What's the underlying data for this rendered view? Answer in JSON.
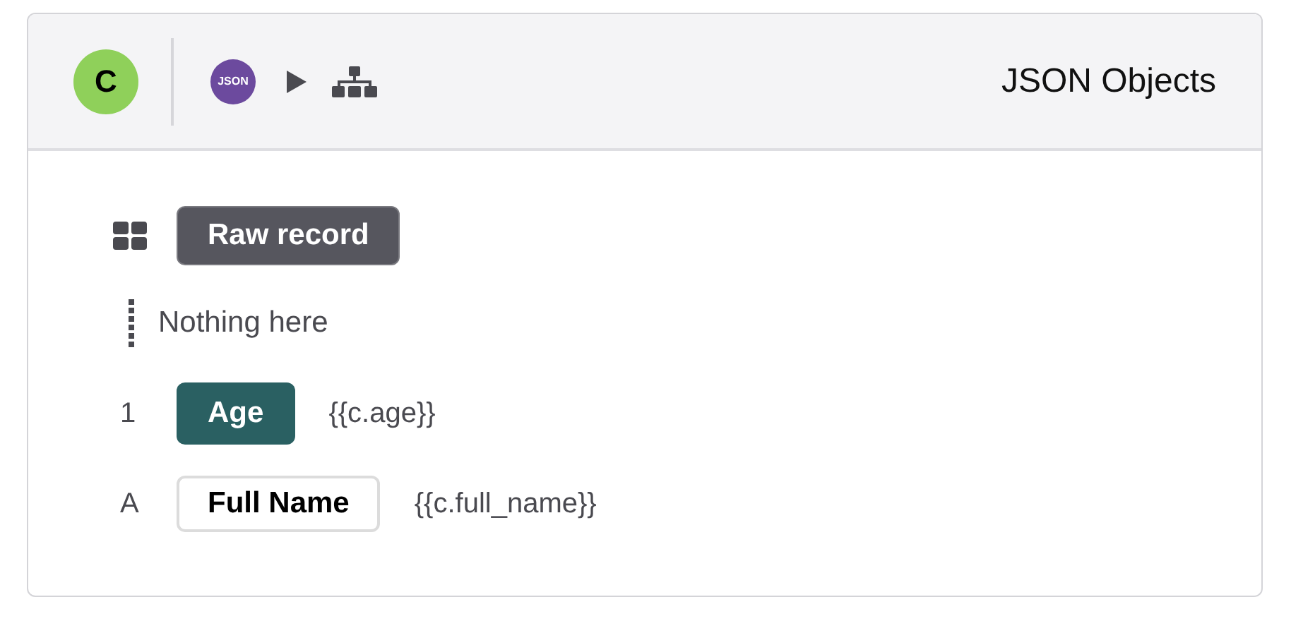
{
  "header": {
    "avatar": "C",
    "logo": "JSON",
    "title": "JSON Objects"
  },
  "rows": [
    {
      "kind": "object",
      "label": "Raw record"
    },
    {
      "kind": "empty",
      "label": "Nothing here"
    },
    {
      "kind": "number",
      "marker": "1",
      "label": "Age",
      "value": "{{c.age}}"
    },
    {
      "kind": "text",
      "marker": "A",
      "label": "Full Name",
      "value": "{{c.full_name}}"
    }
  ]
}
